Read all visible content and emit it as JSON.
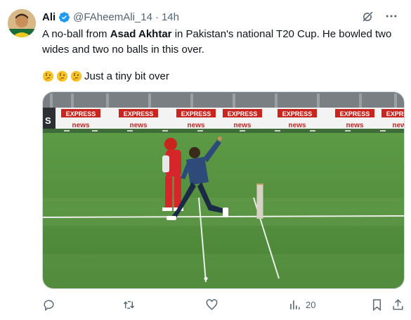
{
  "author": {
    "display_name": "Ali",
    "handle": "@FAheemAli_14",
    "separator": "·",
    "time": "14h",
    "verified": true
  },
  "tweet": {
    "text_before_1": "A no-ball from ",
    "bold_1": "Asad Akhtar",
    "text_after_1": " in Pakistan's national T20 Cup. He bowled two wides and two no balls in this over.",
    "line2_emojis": [
      "thinking-face-emoji",
      "thinking-face-emoji",
      "thinking-face-emoji"
    ],
    "line2_text": "Just a tiny bit over"
  },
  "media": {
    "banner_text": [
      "EXPRESS",
      "news"
    ],
    "scoreboard_fragment": "S"
  },
  "actions": {
    "reply_count": "",
    "retweet_count": "",
    "like_count": "",
    "views_count": "20"
  },
  "colors": {
    "verified_blue": "#1d9bf0",
    "muted_text": "#536471",
    "pitch_green": "#4f8a3a"
  }
}
